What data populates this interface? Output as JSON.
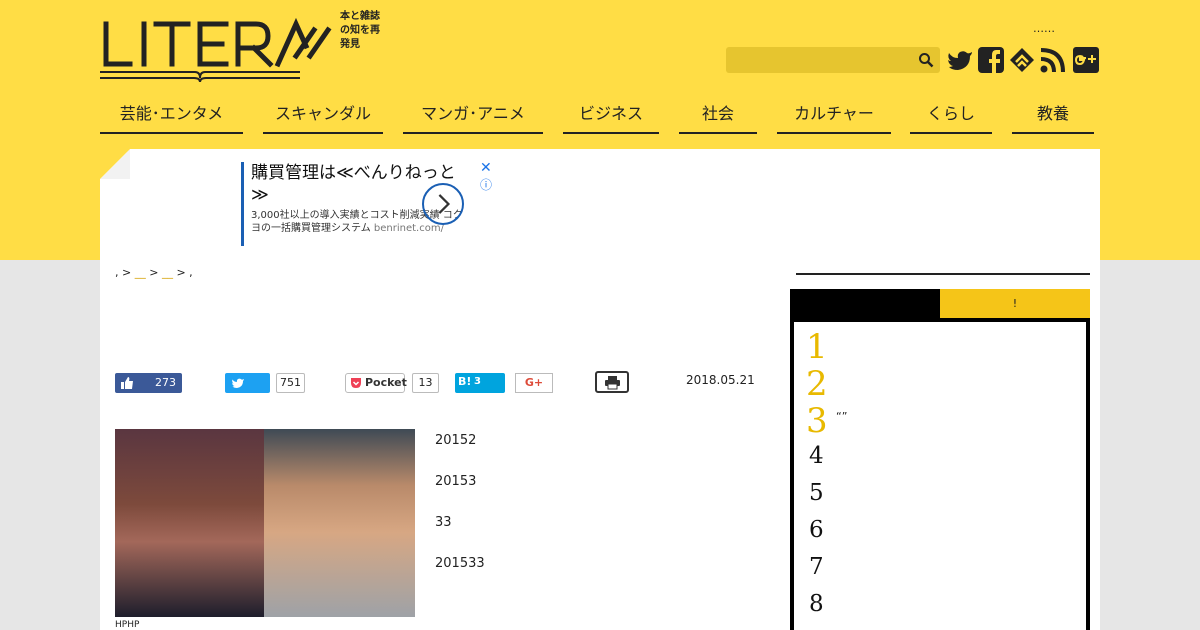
{
  "header": {
    "tagline": "本と雑誌の知を再発見",
    "top_dots": "……"
  },
  "nav": [
    "芸能･エンタメ",
    "スキャンダル",
    "マンガ･アニメ",
    "ビジネス",
    "社会",
    "カルチャー",
    "くらし",
    "教養"
  ],
  "ad": {
    "title": "購買管理は≪べんりねっと≫",
    "desc": "3,000社以上の導入実績とコスト削減実績 コクヨの一括購買管理システム",
    "url": "benrinet.com/",
    "close": "✕",
    "info": "ⓘ"
  },
  "breadcrumb": {
    "a": ",",
    "sep": ">",
    "b": "__",
    "c": "__",
    "d": ","
  },
  "share": {
    "like_count": "273",
    "tweet_count": "751",
    "pocket_label": "Pocket",
    "pocket_count": "13",
    "hatena_label": "B!",
    "hatena_count": "3",
    "gplus_label": "G+"
  },
  "article": {
    "date": "2018.05.21",
    "caption": "HPHP",
    "paragraphs": [
      "20152",
      "20153",
      "33",
      "201533"
    ]
  },
  "sidebar": {
    "tab2_label": "!",
    "ranks": [
      "1",
      "2",
      "3",
      "4",
      "5",
      "6",
      "7",
      "8"
    ],
    "rank3_text": "“”"
  },
  "colors": {
    "brand_yellow": "#ffdd45",
    "accent_gold": "#f5c518",
    "facebook": "#3b5998",
    "twitter": "#1da1f2",
    "hatena": "#00a4de"
  }
}
